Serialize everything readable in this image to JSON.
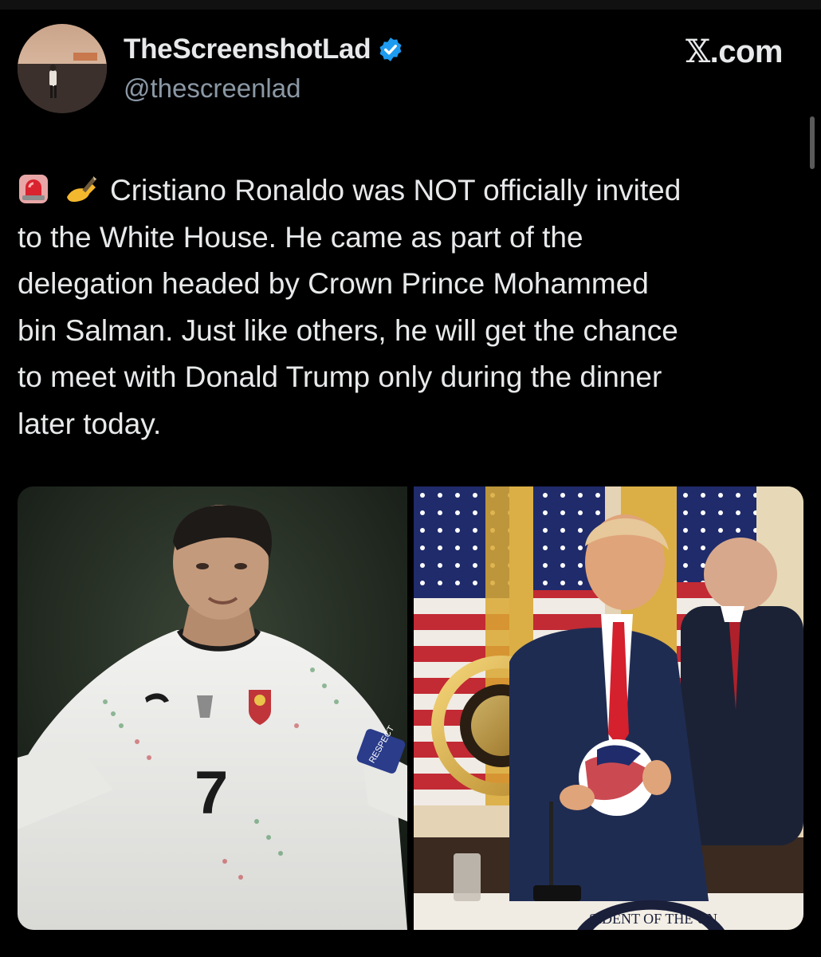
{
  "user": {
    "display_name": "TheScreenshotLad",
    "handle": "@thescreenlad",
    "verified": true,
    "avatar_icon": "avatar-photo"
  },
  "brand": {
    "x_glyph": "𝕏",
    "suffix": ".com"
  },
  "post": {
    "emojis": [
      "police-light-emoji",
      "writing-hand-emoji"
    ],
    "text": "Cristiano Ronaldo was NOT officially invited\nto the White House. He came as part of the\ndelegation headed by Crown Prince Mohammed\nbin Salman. Just like others, he will get the chance\nto meet with Donald Trump only during the dinner\nlater today."
  },
  "media": {
    "left_jersey_number": "7",
    "left_armband_text": "RESPECT",
    "right_seal_text": "SIDENT OF THE UN"
  },
  "colors": {
    "background": "#000000",
    "text": "#e7e9ea",
    "secondary_text": "#8b98a5",
    "verified_blue": "#1d9bf0"
  }
}
